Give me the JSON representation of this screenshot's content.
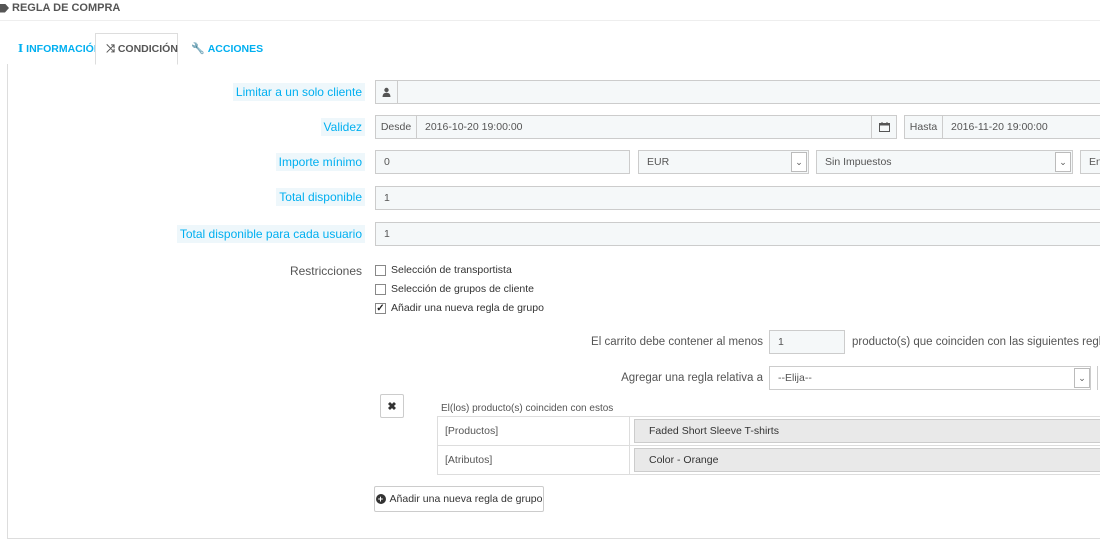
{
  "page_title": "REGLA DE COMPRA",
  "tabs": [
    {
      "label": "INFORMACIÓN",
      "icon": "info-icon"
    },
    {
      "label": "CONDICIÓN",
      "icon": "shuffle-icon"
    },
    {
      "label": "ACCIONES",
      "icon": "wrench-icon"
    }
  ],
  "form": {
    "limit_customer": {
      "label": "Limitar a un solo cliente",
      "value": ""
    },
    "validity": {
      "label": "Validez",
      "from_label": "Desde",
      "from_value": "2016-10-20 19:00:00",
      "to_label": "Hasta",
      "to_value": "2016-11-20 19:00:00"
    },
    "minimum_amount": {
      "label": "Importe mínimo",
      "value": "0",
      "currency": "EUR",
      "tax": "Sin Impuestos",
      "shipping_trunc": "En"
    },
    "total_available": {
      "label": "Total disponible",
      "value": "1"
    },
    "total_per_user": {
      "label": "Total disponible para cada usuario",
      "value": "1"
    },
    "restrictions": {
      "label": "Restricciones",
      "items": [
        {
          "label": "Selección de transportista",
          "checked": false
        },
        {
          "label": "Selección de grupos de cliente",
          "checked": false
        },
        {
          "label": "Añadir una nueva regla de grupo",
          "checked": true
        }
      ]
    },
    "cart_rule": {
      "prefix": "El carrito debe contener al menos",
      "quantity": "1",
      "suffix": "producto(s) que coinciden con las siguientes reglas"
    },
    "add_rule_relative": {
      "label": "Agregar una regla relativa a",
      "value": "--Elija--"
    },
    "rule_group": {
      "title": "El(los) producto(s) coinciden con estos",
      "rows": [
        {
          "type": "[Productos]",
          "value": "Faded Short Sleeve T-shirts"
        },
        {
          "type": "[Atributos]",
          "value": "Color - Orange"
        }
      ]
    },
    "add_group_button": "Añadir una nueva regla de grupo"
  },
  "colors": {
    "accent": "#00aff0",
    "label_bg": "#eef7fb",
    "input_bg": "#f5f8f9"
  }
}
